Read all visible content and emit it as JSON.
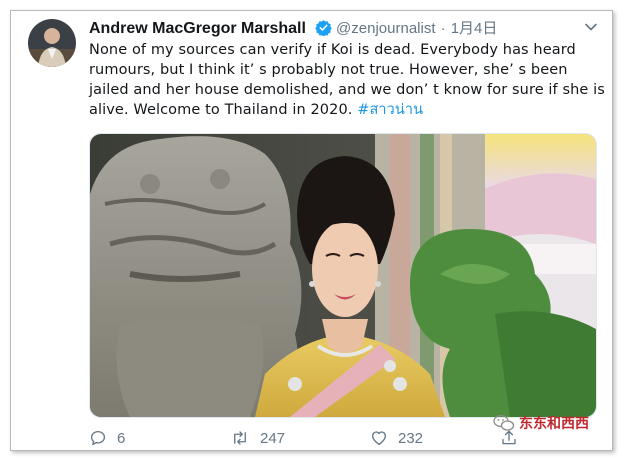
{
  "tweet": {
    "author_name": "Andrew MacGregor Marshall",
    "handle": "@zenjournalist",
    "separator": "·",
    "date": "1月4日",
    "text_lines": [
      "None of my sources can verify if Koi is dead. Everybody has heard",
      "rumours, but I think it’ s probably not true. However, she’ s been",
      "jailed and her house demolished, and we don’ t know for sure if she is",
      "alive. Welcome to Thailand in 2020."
    ],
    "hashtag": "#สาวน่าน",
    "icons": {
      "avatar": "avatar",
      "verified": "verified-badge-icon",
      "menu": "chevron-down-icon"
    },
    "colors": {
      "text": "#14171a",
      "muted": "#657786",
      "link": "#1b95e0",
      "verified": "#1da1f2"
    }
  },
  "actions": {
    "reply_count": "6",
    "retweet_count": "247",
    "like_count": "232"
  },
  "watermark": {
    "text": "东东和西西"
  }
}
